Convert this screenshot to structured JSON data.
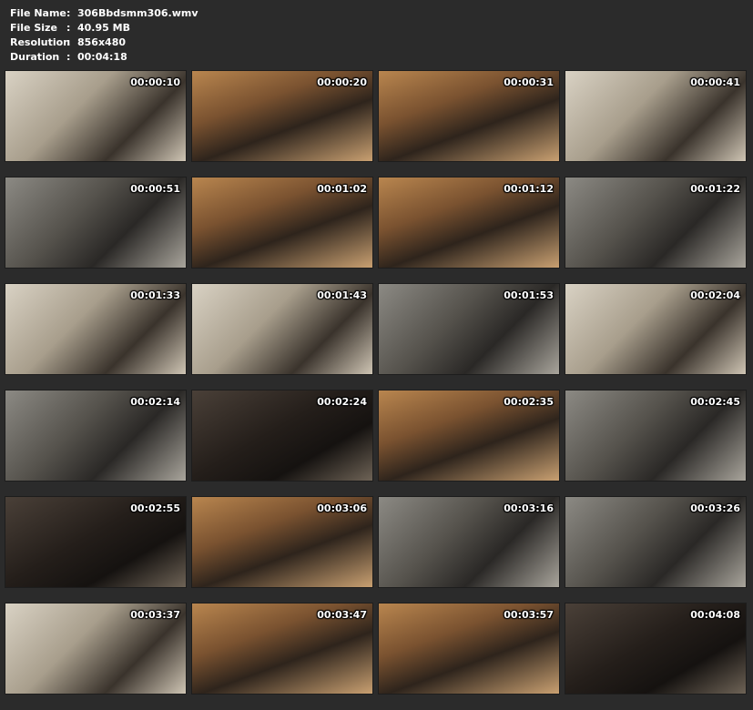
{
  "info": [
    {
      "label": "File Name",
      "value": "306Bbdsmm306.wmv"
    },
    {
      "label": "File Size",
      "value": "40.95 MB"
    },
    {
      "label": "Resolution",
      "value": "856x480"
    },
    {
      "label": "Duration",
      "value": "00:04:18"
    }
  ],
  "separator": ":",
  "thumbnails": [
    {
      "timestamp": "00:00:10",
      "scene": "light"
    },
    {
      "timestamp": "00:00:20",
      "scene": "warm"
    },
    {
      "timestamp": "00:00:31",
      "scene": "warm"
    },
    {
      "timestamp": "00:00:41",
      "scene": "light"
    },
    {
      "timestamp": "00:00:51",
      "scene": "grey"
    },
    {
      "timestamp": "00:01:02",
      "scene": "warm"
    },
    {
      "timestamp": "00:01:12",
      "scene": "warm"
    },
    {
      "timestamp": "00:01:22",
      "scene": "grey"
    },
    {
      "timestamp": "00:01:33",
      "scene": "light"
    },
    {
      "timestamp": "00:01:43",
      "scene": "light"
    },
    {
      "timestamp": "00:01:53",
      "scene": "grey"
    },
    {
      "timestamp": "00:02:04",
      "scene": "light"
    },
    {
      "timestamp": "00:02:14",
      "scene": "grey"
    },
    {
      "timestamp": "00:02:24",
      "scene": "dark"
    },
    {
      "timestamp": "00:02:35",
      "scene": "warm"
    },
    {
      "timestamp": "00:02:45",
      "scene": "grey"
    },
    {
      "timestamp": "00:02:55",
      "scene": "dark"
    },
    {
      "timestamp": "00:03:06",
      "scene": "warm"
    },
    {
      "timestamp": "00:03:16",
      "scene": "grey"
    },
    {
      "timestamp": "00:03:26",
      "scene": "grey"
    },
    {
      "timestamp": "00:03:37",
      "scene": "light"
    },
    {
      "timestamp": "00:03:47",
      "scene": "warm"
    },
    {
      "timestamp": "00:03:57",
      "scene": "warm"
    },
    {
      "timestamp": "00:04:08",
      "scene": "dark"
    }
  ]
}
